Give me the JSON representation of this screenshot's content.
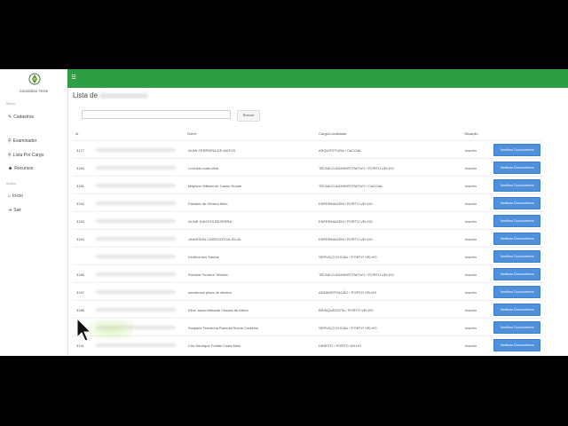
{
  "brand": "Candidato Teste",
  "sidebar": {
    "section_menu": "Menu",
    "item_cadastros": "Cadastros",
    "item_examinador": "Examinador",
    "item_lista": "Lista Por Cargo",
    "item_recursos": "Recursos",
    "section_acoes": "Ações",
    "item_inicio": "Início",
    "item_sair": "Sair"
  },
  "page": {
    "title": "Lista de",
    "search_value": "",
    "search_button": "Buscar"
  },
  "table": {
    "headers": {
      "id": "Id",
      "nome": "Nome",
      "cargo": "Cargo/Localidade",
      "situacao": "Situação"
    },
    "action_label": "Verificar Documentos",
    "rows": [
      {
        "id": "3177",
        "nome": "ALAN FERREIRA DE MATOS",
        "cargo": "ARQUITETURA / CACOAL",
        "situacao": "Inscrito"
      },
      {
        "id": "3180",
        "nome": "Lucineto malo silva",
        "cargo": "TÉCNICO ADMINISTRATIVO / PORTO VELHO",
        "situacao": "Inscrito"
      },
      {
        "id": "3181",
        "nome": "Maylson William de Castro Dumer",
        "cargo": "TÉCNICO ADMINISTRATIVO / CACOAL",
        "situacao": "Inscrito"
      },
      {
        "id": "3182",
        "nome": "Fabiane de Oliveira Melo",
        "cargo": "ENFERMAGEM / PORTO VELHO",
        "situacao": "Inscrito"
      },
      {
        "id": "3183",
        "nome": "ALINE SANTOS BEZERRA",
        "cargo": "ENFERMAGEM / PORTO VELHO",
        "situacao": "Inscrito"
      },
      {
        "id": "3184",
        "nome": "JANISSON CARDOZO DA SILVA",
        "cargo": "ENFERMAGEM / PORTO VELHO",
        "situacao": "Inscrito"
      },
      {
        "id": "",
        "nome": "Droilina dos Santos",
        "cargo": "SERVIÇO SOCIAL / PORTO VELHO",
        "situacao": "Inscrito"
      },
      {
        "id": "3186",
        "nome": "Romilde Ferreira Teixeira",
        "cargo": "TÉCNICO ADMINISTRATIVO / PORTO VELHO",
        "situacao": "Inscrito"
      },
      {
        "id": "3187",
        "nome": "uanderson jesus de oliveira",
        "cargo": "ADMINISTRAÇÃO / PORTO VELHO",
        "situacao": "Inscrito"
      },
      {
        "id": "3188",
        "nome": "Eline Jaíza brilhante Chaves de Abreu",
        "cargo": "BRINQUEDISTA / PORTO VELHO",
        "situacao": "Inscrito"
      },
      {
        "id": "3190",
        "nome": "Rosjiane Teresinha Roberta Rocha Coutinho",
        "cargo": "SERVIÇO SOCIAL / PORTO VELHO",
        "situacao": "Inscrito"
      },
      {
        "id": "3191",
        "nome": "Ciro Henrique Freitas Costa Neto",
        "cargo": "DIREITO / PORTO VELHO",
        "situacao": "Inscrito"
      }
    ]
  },
  "colors": {
    "topbar": "#2e9e44",
    "button": "#4e90d9"
  }
}
